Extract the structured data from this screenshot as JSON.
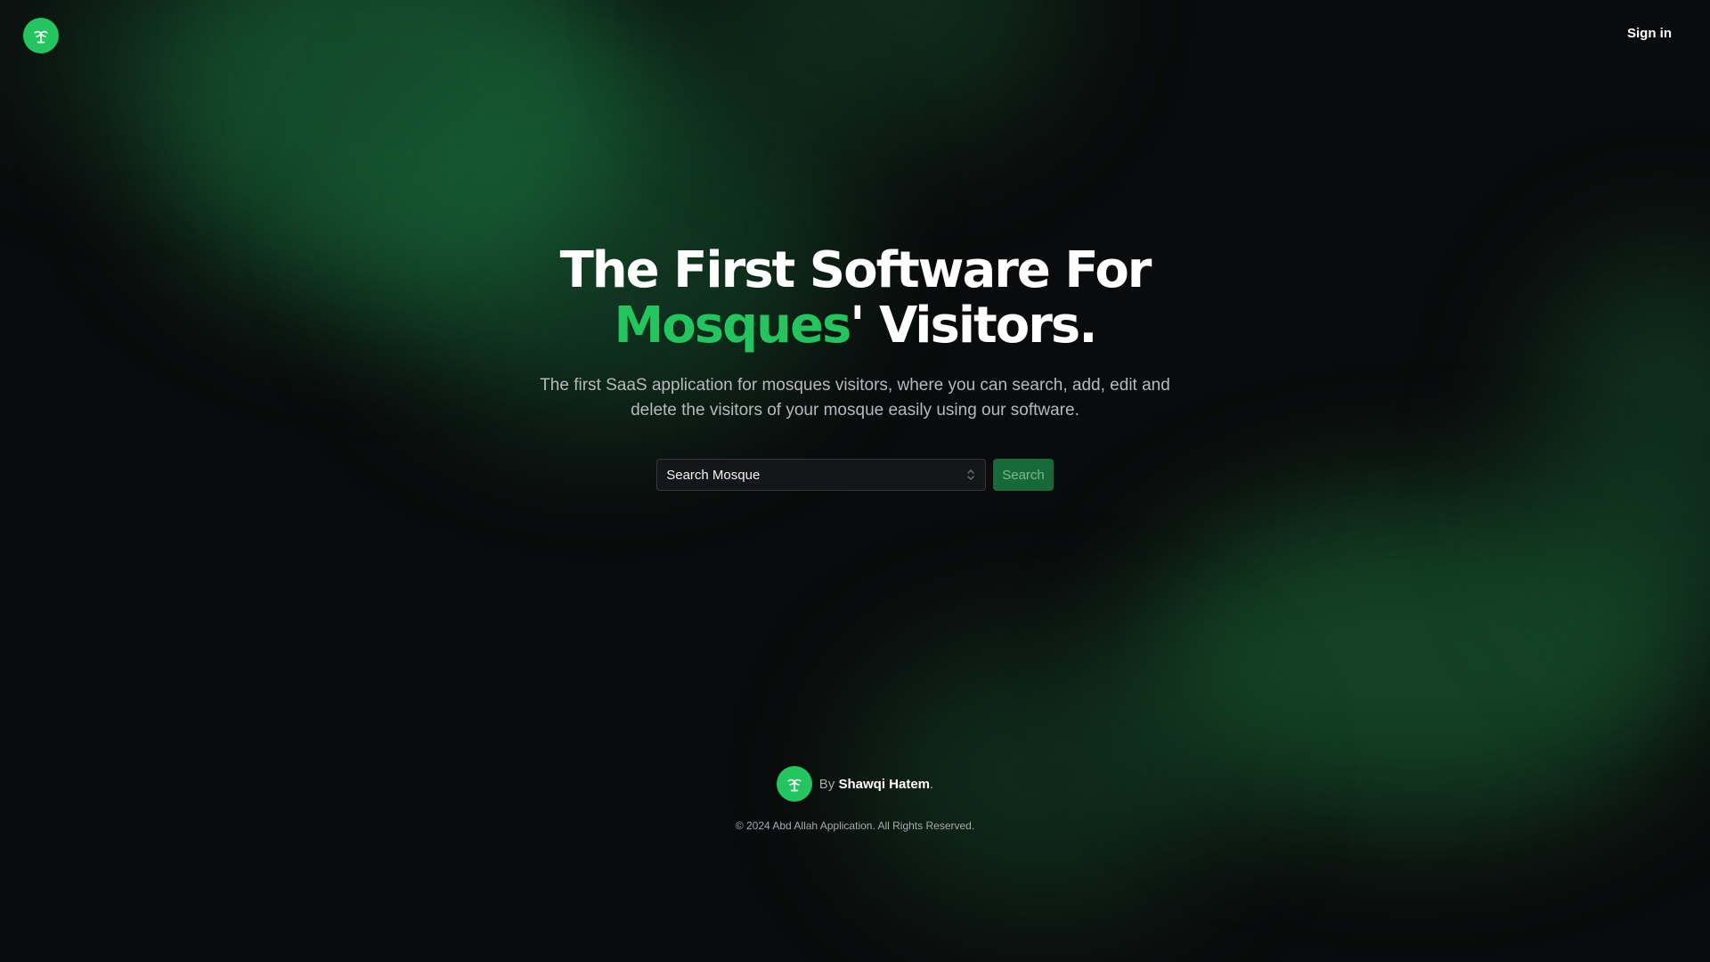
{
  "header": {
    "logo_icon": "palm-tree-icon",
    "signin_label": "Sign in"
  },
  "hero": {
    "headline_line1": "The First Software For",
    "headline_accent": "Mosques",
    "headline_rest": "' Visitors.",
    "subtitle": "The first SaaS application for mosques visitors, where you can search, add, edit and delete the visitors of your mosque easily using our software."
  },
  "search": {
    "select_value": "Search Mosque",
    "button_label": "Search"
  },
  "footer": {
    "logo_icon": "palm-tree-icon",
    "by_label": "By",
    "author": "Shawqi Hatem",
    "period": ".",
    "copyright": "© 2024 Abd Allah Application. All Rights Reserved."
  },
  "colors": {
    "accent": "#22c55e",
    "background": "#0a0b0c",
    "button": "#176a37"
  }
}
